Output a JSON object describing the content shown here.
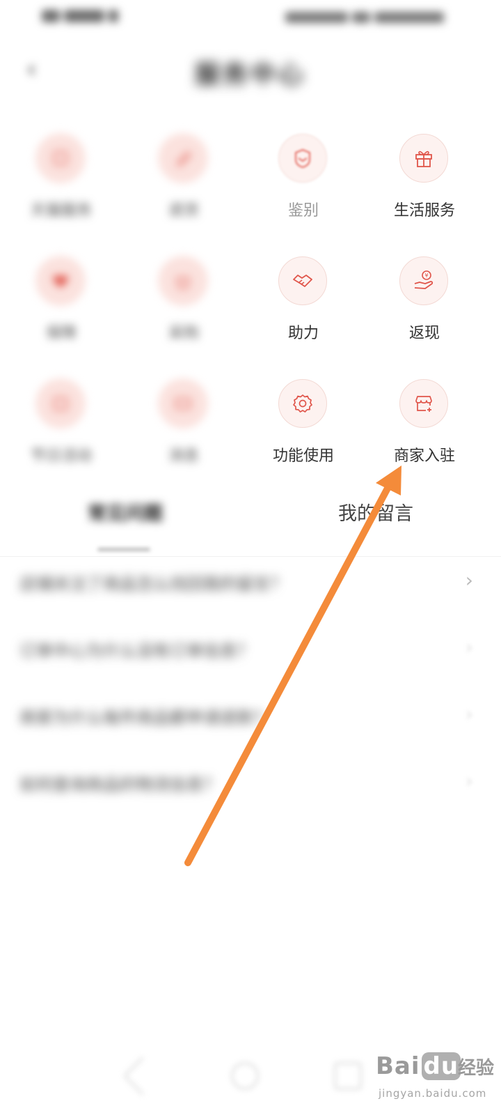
{
  "header": {
    "title": "服务中心",
    "back_icon": "chevron-left-icon"
  },
  "grid": {
    "items": [
      {
        "id": "tianmao-service",
        "label": "天猫服务",
        "icon": "badge-icon",
        "blurred": true
      },
      {
        "id": "return",
        "label": "退货",
        "icon": "pen-icon",
        "blurred": true
      },
      {
        "id": "jianbie",
        "label": "鉴别",
        "icon": "shield-icon",
        "blurred": false,
        "faded": true
      },
      {
        "id": "life-service",
        "label": "生活服务",
        "icon": "gift-icon",
        "blurred": false
      },
      {
        "id": "protect",
        "label": "保障",
        "icon": "heart-icon",
        "blurred": true
      },
      {
        "id": "purchase",
        "label": "采购",
        "icon": "bag-icon",
        "blurred": true
      },
      {
        "id": "zhuli",
        "label": "助力",
        "icon": "handshake-icon",
        "blurred": false
      },
      {
        "id": "fanxian",
        "label": "返现",
        "icon": "cashback-hand-icon",
        "blurred": false
      },
      {
        "id": "calendar",
        "label": "节日活动",
        "icon": "calendar-icon",
        "blurred": true
      },
      {
        "id": "message",
        "label": "消息",
        "icon": "mail-icon",
        "blurred": true
      },
      {
        "id": "function-use",
        "label": "功能使用",
        "icon": "gear-icon",
        "blurred": false
      },
      {
        "id": "merchant-join",
        "label": "商家入驻",
        "icon": "store-add-icon",
        "blurred": false
      }
    ]
  },
  "tabs": {
    "faq": "常见问题",
    "messages": "我的留言"
  },
  "faq": {
    "items": [
      "店铺关注了商品怎么找回我的留言？",
      "订单中心为什么没有订单信息？",
      "商家为什么每件商品都申请退款？",
      "如何查询商品的物流信息？"
    ]
  },
  "watermark": {
    "brand_bai": "Bai",
    "brand_du": "du",
    "brand_jy": "经验",
    "url": "jingyan.baidu.com"
  },
  "colors": {
    "arrow": "#f48b3a",
    "icon_stroke": "#e0554a",
    "icon_bg": "#fdf2f0"
  }
}
